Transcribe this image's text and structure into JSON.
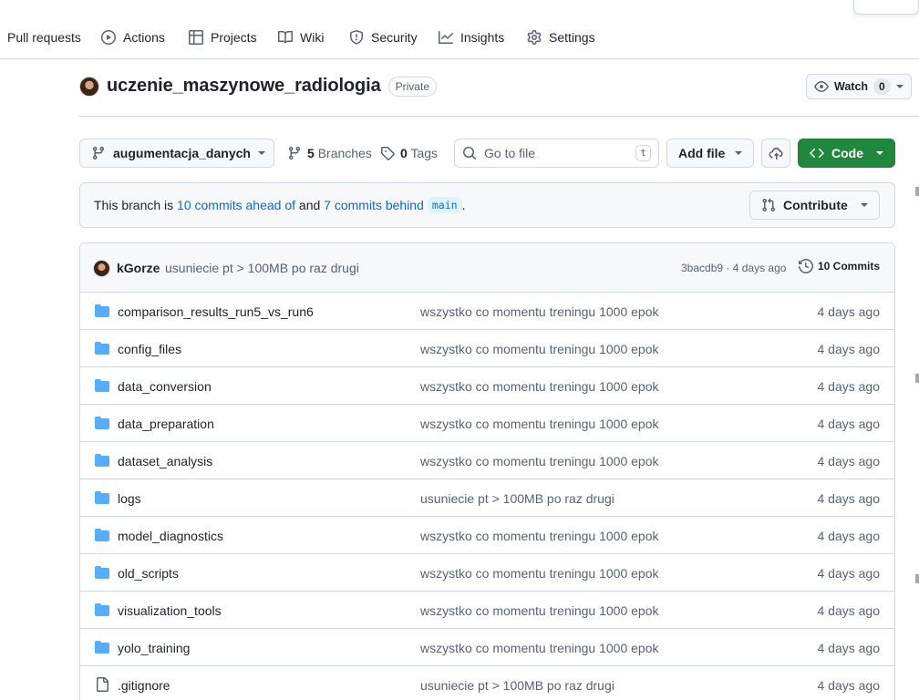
{
  "nav": {
    "items": [
      {
        "label": "Pull requests",
        "icon": "pull-request-icon"
      },
      {
        "label": "Actions",
        "icon": "play-icon"
      },
      {
        "label": "Projects",
        "icon": "table-icon"
      },
      {
        "label": "Wiki",
        "icon": "book-icon"
      },
      {
        "label": "Security",
        "icon": "shield-icon"
      },
      {
        "label": "Insights",
        "icon": "graph-icon"
      },
      {
        "label": "Settings",
        "icon": "gear-icon"
      }
    ]
  },
  "repo": {
    "name": "uczenie_maszynowe_radiologia",
    "visibility": "Private",
    "watch_label": "Watch",
    "watch_count": "0"
  },
  "toolbar": {
    "branch": "augumentacja_danych",
    "branches_count": "5",
    "branches_label": "Branches",
    "tags_count": "0",
    "tags_label": "Tags",
    "search_placeholder": "Go to file",
    "search_shortcut": "t",
    "add_file_label": "Add file",
    "code_label": "Code"
  },
  "branch_status": {
    "prefix": "This branch is",
    "ahead_link": "10 commits ahead of",
    "and": "and",
    "behind_link": "7 commits behind",
    "base_branch": "main",
    "suffix": ".",
    "contribute_label": "Contribute"
  },
  "latest_commit": {
    "author": "kGorze",
    "message": "usuniecie pt > 100MB po raz drugi",
    "sha_and_time": "3bacdb9 · 4 days ago",
    "commits_label": "10 Commits"
  },
  "files": [
    {
      "name": "comparison_results_run5_vs_run6",
      "type": "folder",
      "message": "wszystko co momentu treningu 1000 epok",
      "date": "4 days ago"
    },
    {
      "name": "config_files",
      "type": "folder",
      "message": "wszystko co momentu treningu 1000 epok",
      "date": "4 days ago"
    },
    {
      "name": "data_conversion",
      "type": "folder",
      "message": "wszystko co momentu treningu 1000 epok",
      "date": "4 days ago"
    },
    {
      "name": "data_preparation",
      "type": "folder",
      "message": "wszystko co momentu treningu 1000 epok",
      "date": "4 days ago"
    },
    {
      "name": "dataset_analysis",
      "type": "folder",
      "message": "wszystko co momentu treningu 1000 epok",
      "date": "4 days ago"
    },
    {
      "name": "logs",
      "type": "folder",
      "message": "usuniecie pt > 100MB po raz drugi",
      "date": "4 days ago"
    },
    {
      "name": "model_diagnostics",
      "type": "folder",
      "message": "wszystko co momentu treningu 1000 epok",
      "date": "4 days ago"
    },
    {
      "name": "old_scripts",
      "type": "folder",
      "message": "wszystko co momentu treningu 1000 epok",
      "date": "4 days ago"
    },
    {
      "name": "visualization_tools",
      "type": "folder",
      "message": "wszystko co momentu treningu 1000 epok",
      "date": "4 days ago"
    },
    {
      "name": "yolo_training",
      "type": "folder",
      "message": "wszystko co momentu treningu 1000 epok",
      "date": "4 days ago"
    },
    {
      "name": ".gitignore",
      "type": "file",
      "message": "usuniecie pt > 100MB po raz drugi",
      "date": "4 days ago"
    }
  ],
  "colors": {
    "accent_green": "#1f883d",
    "link_blue": "#0969da",
    "folder_blue": "#54aeff",
    "border": "#d1d9e0"
  }
}
